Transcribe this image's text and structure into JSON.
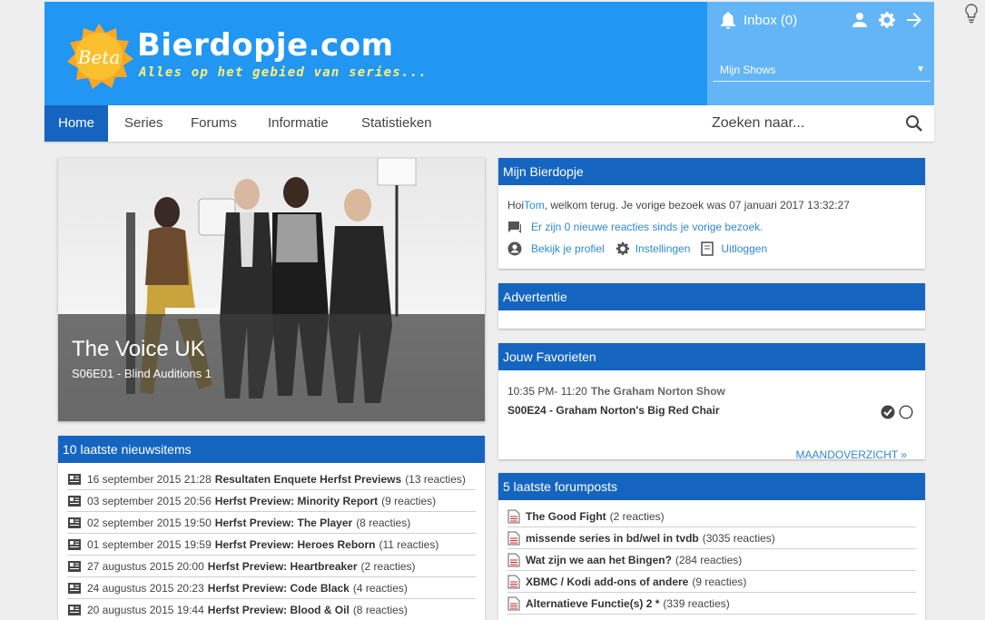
{
  "header": {
    "logo_badge": "Beta",
    "logo_title": "Bierdopje.com",
    "logo_tagline": "Alles op het gebied van series...",
    "inbox_label": "Inbox (0)",
    "myshows_label": "Mijn Shows"
  },
  "nav": {
    "items": [
      "Home",
      "Series",
      "Forums",
      "Informatie",
      "Statistieken"
    ],
    "search_placeholder": "Zoeken naar..."
  },
  "hero": {
    "title": "The Voice UK",
    "subtitle": "S06E01 - Blind Auditions 1"
  },
  "mijn": {
    "heading": "Mijn Bierdopje",
    "greeting_pre": "Hoi ",
    "user": "Tom",
    "greeting_post": ", welkom terug. Je vorige bezoek was 07 januari 2017 13:32:27",
    "reactions": "Er zijn 0 nieuwe reacties sinds je vorige bezoek.",
    "profile": "Bekijk je profiel",
    "settings": "Instellingen",
    "logout": "Uitloggen"
  },
  "ad": {
    "heading": "Advertentie"
  },
  "fav": {
    "heading": "Jouw Favorieten",
    "time": "10:35 PM- 11:20",
    "show": "The Graham Norton Show",
    "episode": "S00E24 - Graham Norton's Big Red Chair",
    "overview": "MAANDOVERZICHT »"
  },
  "news": {
    "heading": "10 laatste nieuwsitems",
    "items": [
      {
        "date": "16 september 2015 21:28",
        "title": "Resultaten Enquete Herfst Previews",
        "count": "(13 reacties)"
      },
      {
        "date": "03 september 2015 20:56",
        "title": "Herfst Preview: Minority Report",
        "count": "(9 reacties)"
      },
      {
        "date": "02 september 2015 19:50",
        "title": "Herfst Preview: The Player",
        "count": "(8 reacties)"
      },
      {
        "date": "01 september 2015 19:59",
        "title": "Herfst Preview: Heroes Reborn",
        "count": "(11 reacties)"
      },
      {
        "date": "27 augustus 2015 20:00",
        "title": "Herfst Preview: Heartbreaker",
        "count": "(2 reacties)"
      },
      {
        "date": "24 augustus 2015 20:23",
        "title": "Herfst Preview: Code Black",
        "count": "(4 reacties)"
      },
      {
        "date": "20 augustus 2015 19:44",
        "title": "Herfst Preview: Blood & Oil",
        "count": "(8 reacties)"
      }
    ]
  },
  "forum": {
    "heading": "5 laatste forumposts",
    "items": [
      {
        "title": "The Good Fight",
        "count": "(2 reacties)"
      },
      {
        "title": "missende series in bd/wel in tvdb",
        "count": "(3035 reacties)"
      },
      {
        "title": "Wat zijn we aan het Bingen?",
        "count": "(284 reacties)"
      },
      {
        "title": "XBMC / Kodi add-ons of andere",
        "count": "(9 reacties)"
      },
      {
        "title": "Alternatieve Functie(s) 2 *",
        "count": "(339 reacties)"
      }
    ]
  }
}
